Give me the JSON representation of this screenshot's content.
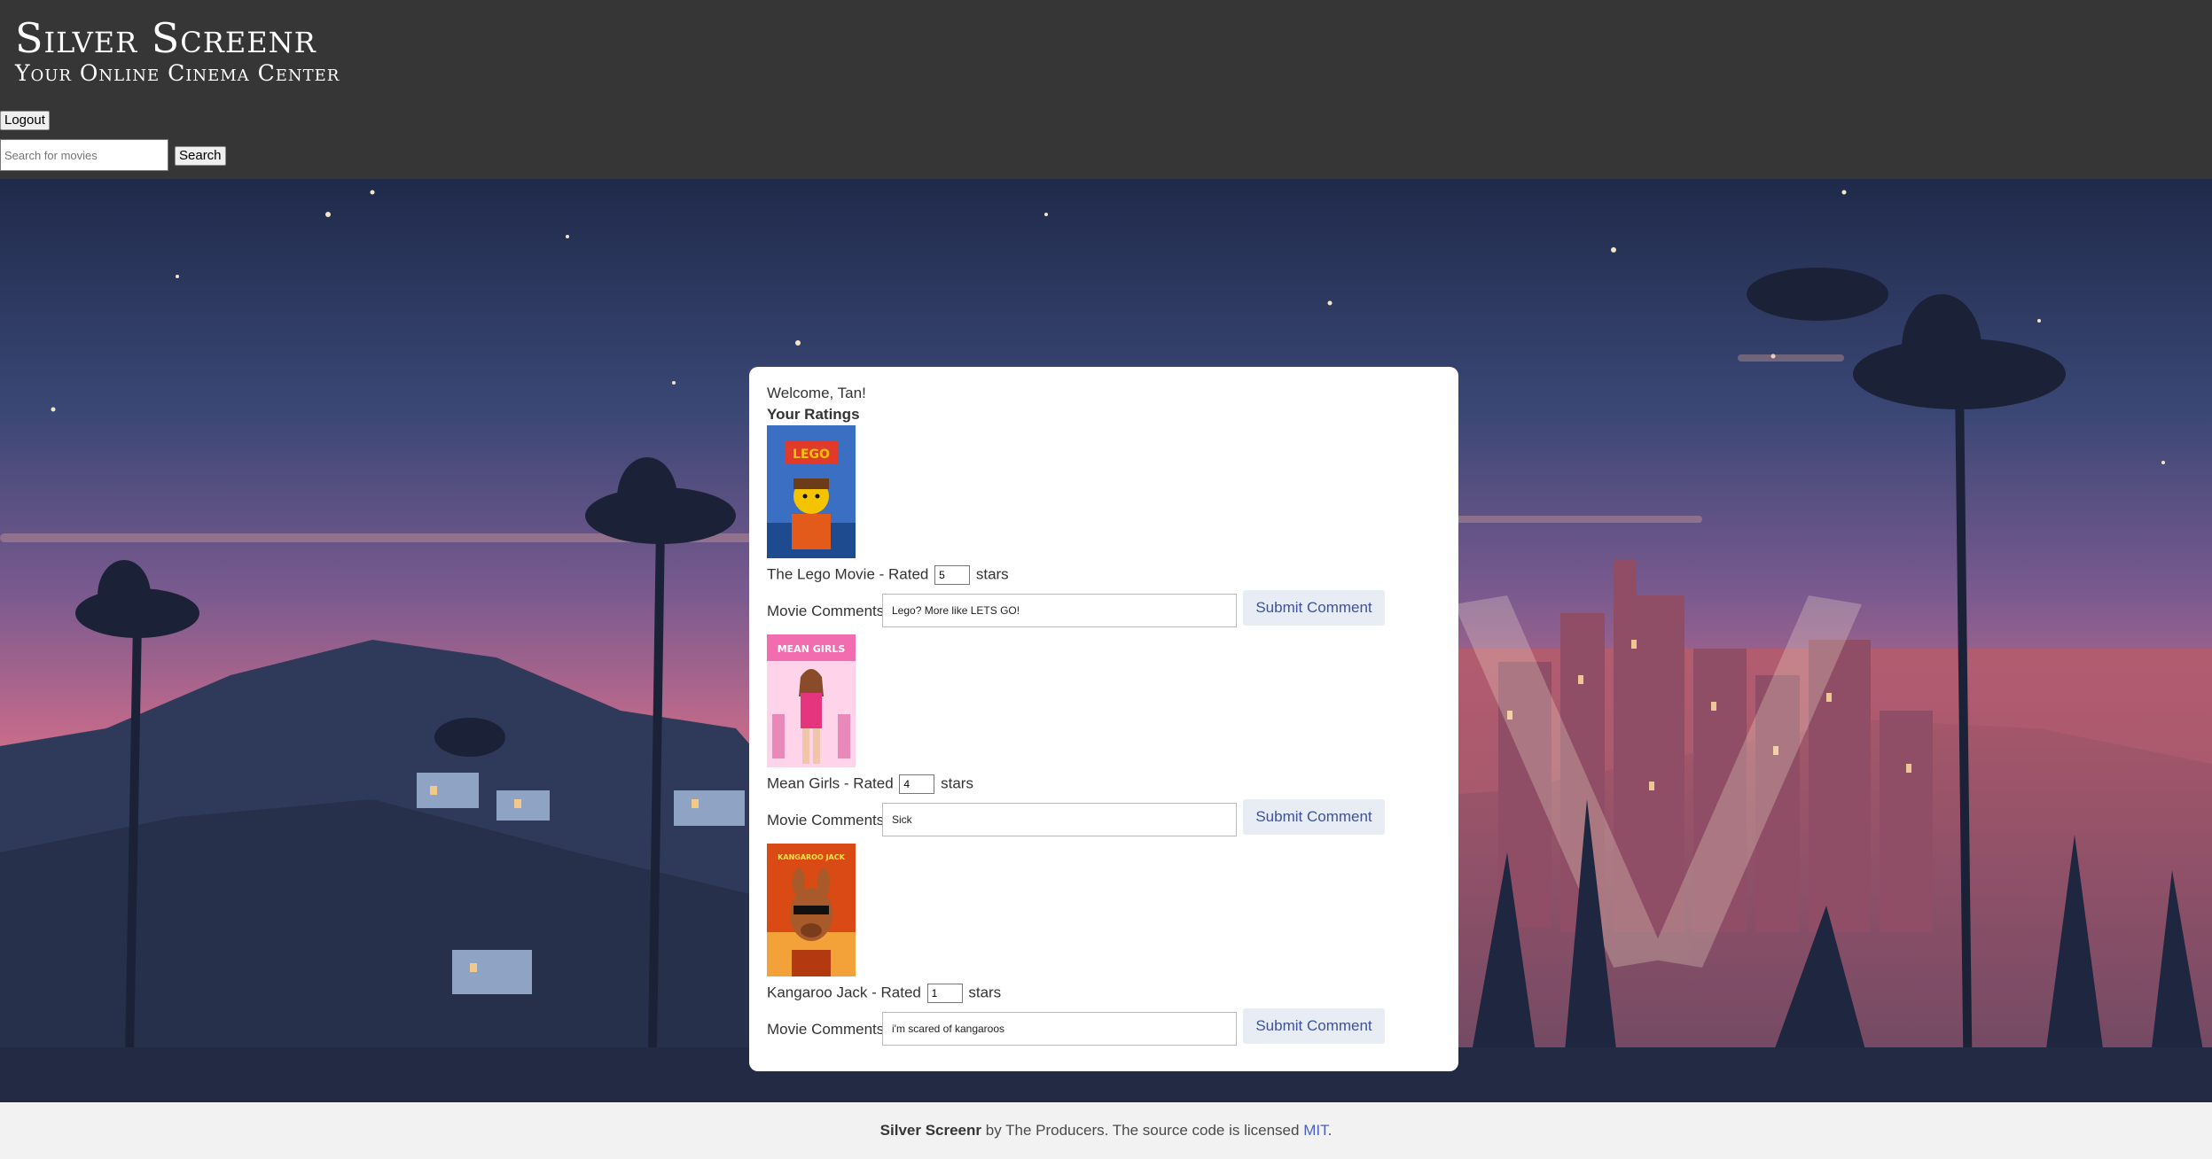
{
  "header": {
    "title": "Silver Screenr",
    "tagline": "Your Online Cinema Center",
    "logout_label": "Logout",
    "search_placeholder": "Search for movies",
    "search_label": "Search"
  },
  "card": {
    "welcome": "Welcome, Tan!",
    "section_title": "Your Ratings",
    "rated_prefix": " - Rated ",
    "rated_suffix": "stars",
    "comments_label": "Movie Comments",
    "submit_label": "Submit Comment",
    "movies": [
      {
        "title": "The Lego Movie",
        "rating": "5",
        "comment": "Lego? More like LETS GO!",
        "poster_text": "LEGO",
        "poster_colors": [
          "#3a6fc4",
          "#f5c400"
        ]
      },
      {
        "title": "Mean Girls",
        "rating": "4",
        "comment": "Sick",
        "poster_text": "MEAN GIRLS",
        "poster_colors": [
          "#f26db0",
          "#ffd3ea"
        ]
      },
      {
        "title": "Kangaroo Jack",
        "rating": "1",
        "comment": "i'm scared of kangaroos",
        "poster_text": "KANGAROO JACK",
        "poster_colors": [
          "#d94a14",
          "#f3a23a"
        ]
      }
    ]
  },
  "footer": {
    "brand": "Silver Screenr",
    "text": " by The Producers. The source code is licensed ",
    "link": "MIT",
    "end": "."
  }
}
